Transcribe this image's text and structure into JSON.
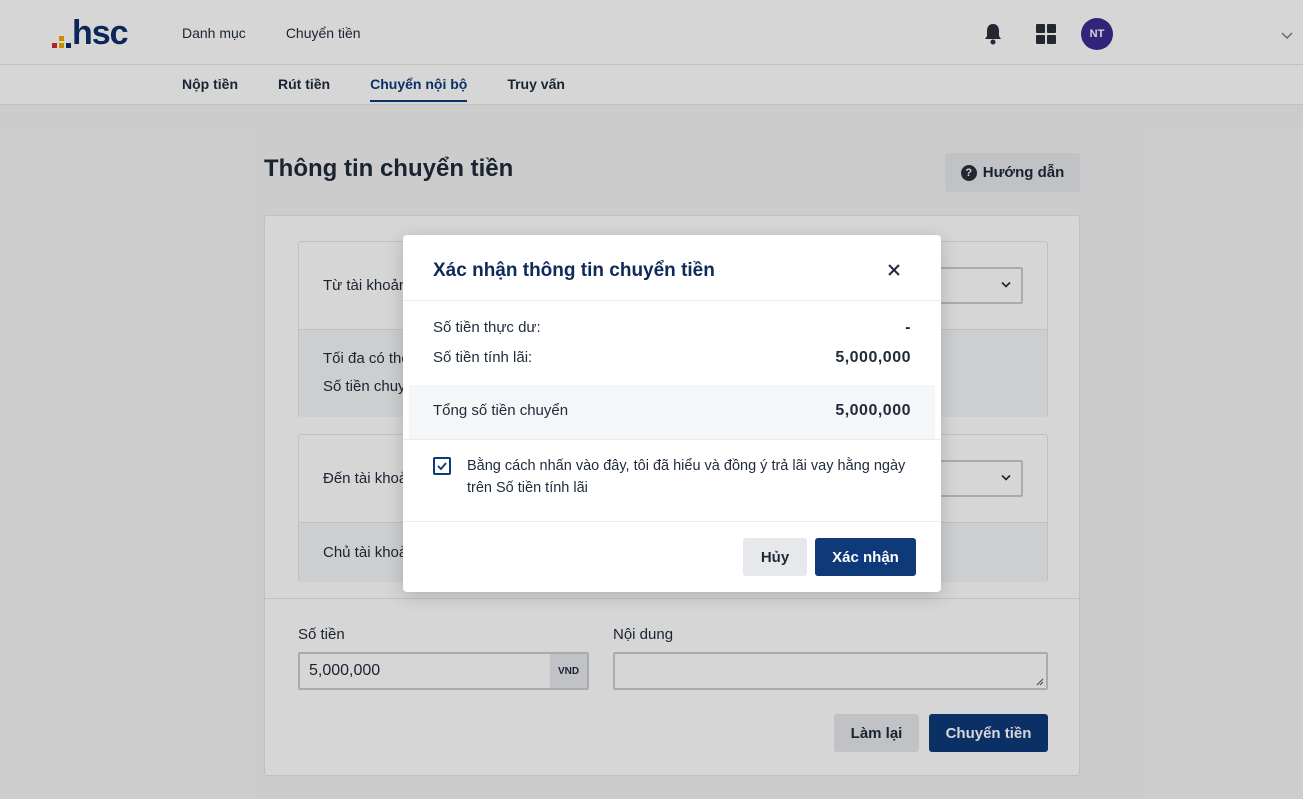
{
  "header": {
    "logo_text": "hsc",
    "nav": [
      "Danh mục",
      "Chuyển tiền"
    ],
    "avatar_initials": "NT"
  },
  "subnav": {
    "items": [
      "Nộp tiền",
      "Rút tiền",
      "Chuyển nội bộ",
      "Truy vấn"
    ],
    "active": "Chuyển nội bộ"
  },
  "page": {
    "title": "Thông tin chuyển tiền",
    "guide_label": "Hướng dẫn"
  },
  "from_panel": {
    "label": "Từ tài khoản",
    "info_lines": [
      "Tối đa có thể",
      "Số tiền chuy"
    ]
  },
  "to_panel": {
    "label": "Đến tài khoản",
    "info_lines": [
      "Chủ tài khoản"
    ]
  },
  "form": {
    "amount_label": "Số tiền",
    "amount_value": "5,000,000",
    "amount_unit": "VND",
    "note_label": "Nội dung",
    "note_value": "",
    "reset_label": "Làm lại",
    "submit_label": "Chuyển tiền"
  },
  "modal": {
    "title": "Xác nhận thông tin chuyển tiền",
    "rows": [
      {
        "label": "Số tiền thực dư:",
        "value": "-"
      },
      {
        "label": "Số tiền tính lãi:",
        "value": "5,000,000"
      }
    ],
    "total_label": "Tổng số tiền chuyển",
    "total_value": "5,000,000",
    "consent_checked": true,
    "consent_text": "Bằng cách nhấn vào đây, tôi đã hiểu và đồng ý trả lãi vay hằng ngày trên Số tiền tính lãi",
    "cancel_label": "Hủy",
    "confirm_label": "Xác nhận"
  },
  "colors": {
    "primary": "#0e3a7a",
    "avatar": "#3b2c92",
    "logo_text": "#0e2e6b"
  }
}
